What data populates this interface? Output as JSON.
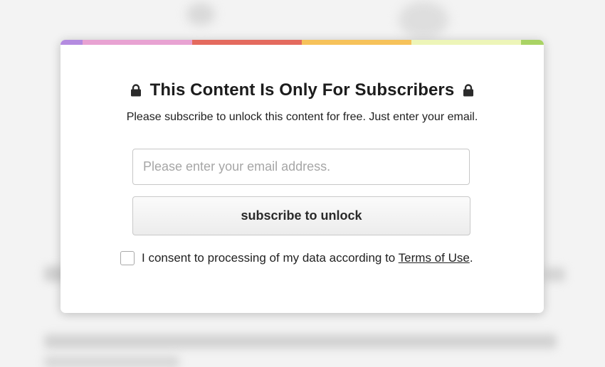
{
  "theme": {
    "stripe_colors": [
      "#b48be0",
      "#e8a2d2",
      "#e46a5e",
      "#f6c25a",
      "#edf5b8",
      "#a9d364"
    ],
    "page_background": "#f3f3f3",
    "modal_background": "#ffffff"
  },
  "modal": {
    "title": "This Content Is Only For Subscribers",
    "title_icon": "lock-icon",
    "subtitle": "Please subscribe to unlock this content for free. Just enter your email.",
    "email_placeholder": "Please enter your email address.",
    "email_value": "",
    "submit_label": "subscribe to unlock",
    "consent": {
      "checked": false,
      "text_before": "I consent to processing of my data according to ",
      "link_label": "Terms of Use",
      "text_after": "."
    }
  }
}
